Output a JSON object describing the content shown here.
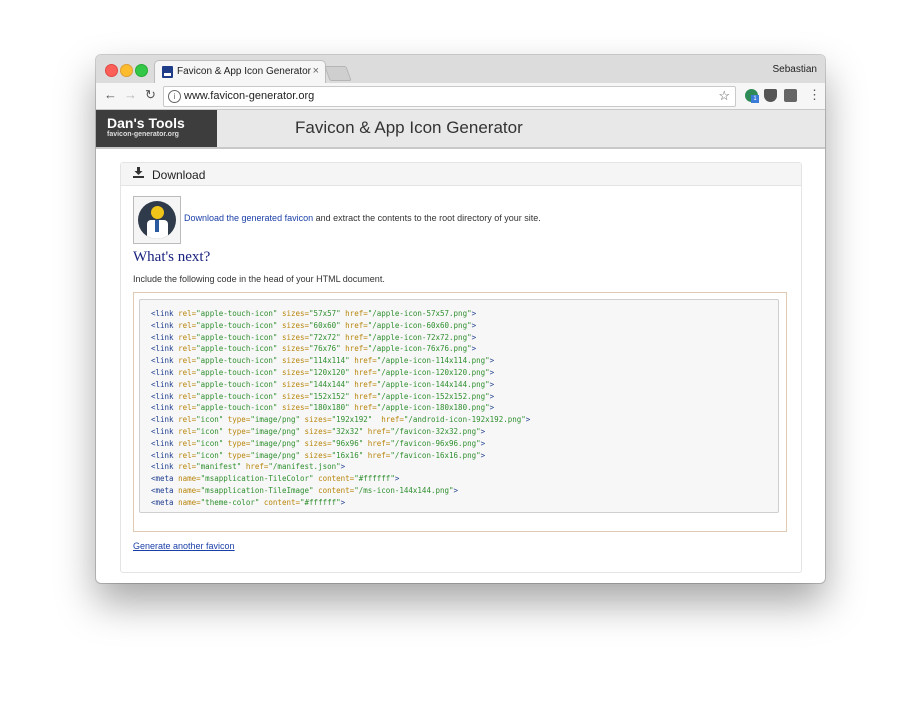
{
  "browser": {
    "tab_title": "Favicon & App Icon Generator",
    "tab_close": "×",
    "profile_name": "Sebastian",
    "url": "www.favicon-generator.org",
    "nav": {
      "back": "←",
      "forward": "→",
      "reload": "↻"
    },
    "star": "☆",
    "menu": "⋮"
  },
  "site": {
    "logo_title": "Dan's Tools",
    "logo_subtitle": "favicon-generator.org",
    "header_title": "Favicon & App Icon Generator"
  },
  "panel": {
    "title": "Download",
    "download_link": "Download the generated favicon",
    "download_rest": " and extract the contents to the root directory of your site.",
    "whats_next": "What's next?",
    "include_text": "Include the following code in the head of your HTML document.",
    "regenerate": "Generate another favicon"
  },
  "code_lines": [
    [
      [
        "tag",
        "<link "
      ],
      [
        "attr",
        "rel="
      ],
      [
        "val",
        "\"apple-touch-icon\" "
      ],
      [
        "attr",
        "sizes="
      ],
      [
        "val",
        "\"57x57\" "
      ],
      [
        "attr",
        "href="
      ],
      [
        "val",
        "\"/apple-icon-57x57.png\""
      ],
      [
        "tag",
        ">"
      ]
    ],
    [
      [
        "tag",
        "<link "
      ],
      [
        "attr",
        "rel="
      ],
      [
        "val",
        "\"apple-touch-icon\" "
      ],
      [
        "attr",
        "sizes="
      ],
      [
        "val",
        "\"60x60\" "
      ],
      [
        "attr",
        "href="
      ],
      [
        "val",
        "\"/apple-icon-60x60.png\""
      ],
      [
        "tag",
        ">"
      ]
    ],
    [
      [
        "tag",
        "<link "
      ],
      [
        "attr",
        "rel="
      ],
      [
        "val",
        "\"apple-touch-icon\" "
      ],
      [
        "attr",
        "sizes="
      ],
      [
        "val",
        "\"72x72\" "
      ],
      [
        "attr",
        "href="
      ],
      [
        "val",
        "\"/apple-icon-72x72.png\""
      ],
      [
        "tag",
        ">"
      ]
    ],
    [
      [
        "tag",
        "<link "
      ],
      [
        "attr",
        "rel="
      ],
      [
        "val",
        "\"apple-touch-icon\" "
      ],
      [
        "attr",
        "sizes="
      ],
      [
        "val",
        "\"76x76\" "
      ],
      [
        "attr",
        "href="
      ],
      [
        "val",
        "\"/apple-icon-76x76.png\""
      ],
      [
        "tag",
        ">"
      ]
    ],
    [
      [
        "tag",
        "<link "
      ],
      [
        "attr",
        "rel="
      ],
      [
        "val",
        "\"apple-touch-icon\" "
      ],
      [
        "attr",
        "sizes="
      ],
      [
        "val",
        "\"114x114\" "
      ],
      [
        "attr",
        "href="
      ],
      [
        "val",
        "\"/apple-icon-114x114.png\""
      ],
      [
        "tag",
        ">"
      ]
    ],
    [
      [
        "tag",
        "<link "
      ],
      [
        "attr",
        "rel="
      ],
      [
        "val",
        "\"apple-touch-icon\" "
      ],
      [
        "attr",
        "sizes="
      ],
      [
        "val",
        "\"120x120\" "
      ],
      [
        "attr",
        "href="
      ],
      [
        "val",
        "\"/apple-icon-120x120.png\""
      ],
      [
        "tag",
        ">"
      ]
    ],
    [
      [
        "tag",
        "<link "
      ],
      [
        "attr",
        "rel="
      ],
      [
        "val",
        "\"apple-touch-icon\" "
      ],
      [
        "attr",
        "sizes="
      ],
      [
        "val",
        "\"144x144\" "
      ],
      [
        "attr",
        "href="
      ],
      [
        "val",
        "\"/apple-icon-144x144.png\""
      ],
      [
        "tag",
        ">"
      ]
    ],
    [
      [
        "tag",
        "<link "
      ],
      [
        "attr",
        "rel="
      ],
      [
        "val",
        "\"apple-touch-icon\" "
      ],
      [
        "attr",
        "sizes="
      ],
      [
        "val",
        "\"152x152\" "
      ],
      [
        "attr",
        "href="
      ],
      [
        "val",
        "\"/apple-icon-152x152.png\""
      ],
      [
        "tag",
        ">"
      ]
    ],
    [
      [
        "tag",
        "<link "
      ],
      [
        "attr",
        "rel="
      ],
      [
        "val",
        "\"apple-touch-icon\" "
      ],
      [
        "attr",
        "sizes="
      ],
      [
        "val",
        "\"180x180\" "
      ],
      [
        "attr",
        "href="
      ],
      [
        "val",
        "\"/apple-icon-180x180.png\""
      ],
      [
        "tag",
        ">"
      ]
    ],
    [
      [
        "tag",
        "<link "
      ],
      [
        "attr",
        "rel="
      ],
      [
        "val",
        "\"icon\" "
      ],
      [
        "attr",
        "type="
      ],
      [
        "val",
        "\"image/png\" "
      ],
      [
        "attr",
        "sizes="
      ],
      [
        "val",
        "\"192x192\"  "
      ],
      [
        "attr",
        "href="
      ],
      [
        "val",
        "\"/android-icon-192x192.png\""
      ],
      [
        "tag",
        ">"
      ]
    ],
    [
      [
        "tag",
        "<link "
      ],
      [
        "attr",
        "rel="
      ],
      [
        "val",
        "\"icon\" "
      ],
      [
        "attr",
        "type="
      ],
      [
        "val",
        "\"image/png\" "
      ],
      [
        "attr",
        "sizes="
      ],
      [
        "val",
        "\"32x32\" "
      ],
      [
        "attr",
        "href="
      ],
      [
        "val",
        "\"/favicon-32x32.png\""
      ],
      [
        "tag",
        ">"
      ]
    ],
    [
      [
        "tag",
        "<link "
      ],
      [
        "attr",
        "rel="
      ],
      [
        "val",
        "\"icon\" "
      ],
      [
        "attr",
        "type="
      ],
      [
        "val",
        "\"image/png\" "
      ],
      [
        "attr",
        "sizes="
      ],
      [
        "val",
        "\"96x96\" "
      ],
      [
        "attr",
        "href="
      ],
      [
        "val",
        "\"/favicon-96x96.png\""
      ],
      [
        "tag",
        ">"
      ]
    ],
    [
      [
        "tag",
        "<link "
      ],
      [
        "attr",
        "rel="
      ],
      [
        "val",
        "\"icon\" "
      ],
      [
        "attr",
        "type="
      ],
      [
        "val",
        "\"image/png\" "
      ],
      [
        "attr",
        "sizes="
      ],
      [
        "val",
        "\"16x16\" "
      ],
      [
        "attr",
        "href="
      ],
      [
        "val",
        "\"/favicon-16x16.png\""
      ],
      [
        "tag",
        ">"
      ]
    ],
    [
      [
        "tag",
        "<link "
      ],
      [
        "attr",
        "rel="
      ],
      [
        "val",
        "\"manifest\" "
      ],
      [
        "attr",
        "href="
      ],
      [
        "val",
        "\"/manifest.json\""
      ],
      [
        "tag",
        ">"
      ]
    ],
    [
      [
        "tag",
        "<meta "
      ],
      [
        "attr",
        "name="
      ],
      [
        "val",
        "\"msapplication-TileColor\" "
      ],
      [
        "attr",
        "content="
      ],
      [
        "val",
        "\"#ffffff\""
      ],
      [
        "tag",
        ">"
      ]
    ],
    [
      [
        "tag",
        "<meta "
      ],
      [
        "attr",
        "name="
      ],
      [
        "val",
        "\"msapplication-TileImage\" "
      ],
      [
        "attr",
        "content="
      ],
      [
        "val",
        "\"/ms-icon-144x144.png\""
      ],
      [
        "tag",
        ">"
      ]
    ],
    [
      [
        "tag",
        "<meta "
      ],
      [
        "attr",
        "name="
      ],
      [
        "val",
        "\"theme-color\" "
      ],
      [
        "attr",
        "content="
      ],
      [
        "val",
        "\"#ffffff\""
      ],
      [
        "tag",
        ">"
      ]
    ]
  ],
  "icons": [
    "download-icon",
    "info-icon",
    "star-icon",
    "menu-icon",
    "avatar-icon"
  ],
  "colors": {
    "link": "#1a3fa8",
    "heading": "#1a237e",
    "logo_bg": "#3d3d3d"
  }
}
